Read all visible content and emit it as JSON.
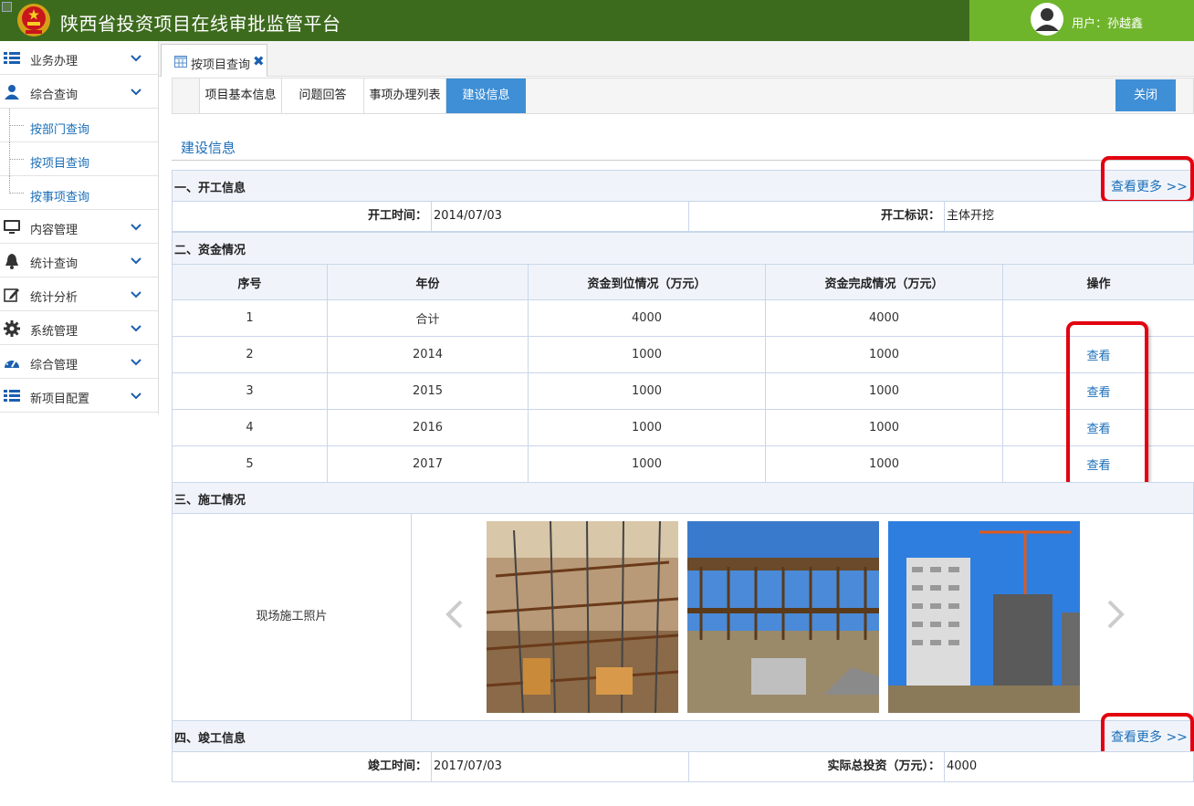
{
  "header": {
    "app_title": "陕西省投资项目在线审批监管平台",
    "user_label": "用户：孙越鑫"
  },
  "sidebar": {
    "items": [
      {
        "label": "业务办理",
        "icon": "list-icon"
      },
      {
        "label": "综合查询",
        "icon": "user-icon"
      },
      {
        "label": "内容管理",
        "icon": "monitor-icon"
      },
      {
        "label": "统计查询",
        "icon": "bell-icon"
      },
      {
        "label": "统计分析",
        "icon": "edit-icon"
      },
      {
        "label": "系统管理",
        "icon": "gear-icon"
      },
      {
        "label": "综合管理",
        "icon": "dashboard-icon"
      },
      {
        "label": "新项目配置",
        "icon": "list-icon"
      }
    ],
    "subitems": [
      {
        "label": "按部门查询"
      },
      {
        "label": "按项目查询"
      },
      {
        "label": "按事项查询"
      }
    ]
  },
  "tabs": {
    "open_tab": "按项目查询",
    "close_glyph": "✖"
  },
  "subtabs": [
    "项目基本信息",
    "问题回答",
    "事项办理列表",
    "建设信息"
  ],
  "close_button": "关闭",
  "section_title": "建设信息",
  "more_label": "查看更多 >>",
  "start": {
    "title": "一、开工信息",
    "time_label": "开工时间：",
    "time_value": "2014/07/03",
    "mark_label": "开工标识：",
    "mark_value": "主体开挖"
  },
  "funds": {
    "title": "二、资金情况",
    "columns": [
      "序号",
      "年份",
      "资金到位情况（万元）",
      "资金完成情况（万元）",
      "操作"
    ],
    "rows": [
      {
        "no": "1",
        "year": "合计",
        "arrived": "4000",
        "done": "4000",
        "op": ""
      },
      {
        "no": "2",
        "year": "2014",
        "arrived": "1000",
        "done": "1000",
        "op": "查看"
      },
      {
        "no": "3",
        "year": "2015",
        "arrived": "1000",
        "done": "1000",
        "op": "查看"
      },
      {
        "no": "4",
        "year": "2016",
        "arrived": "1000",
        "done": "1000",
        "op": "查看"
      },
      {
        "no": "5",
        "year": "2017",
        "arrived": "1000",
        "done": "1000",
        "op": "查看"
      }
    ]
  },
  "construction": {
    "title": "三、施工情况",
    "photo_label": "现场施工照片"
  },
  "completion": {
    "title": "四、竣工信息",
    "time_label": "竣工时间：",
    "time_value": "2017/07/03",
    "invest_label": "实际总投资（万元）：",
    "invest_value": "4000"
  },
  "colors": {
    "header_bg": "#3d6b1e",
    "user_bg": "#6fb52c",
    "accent": "#3f8fd6",
    "link": "#1b6eb8",
    "highlight": "#e3000f"
  }
}
